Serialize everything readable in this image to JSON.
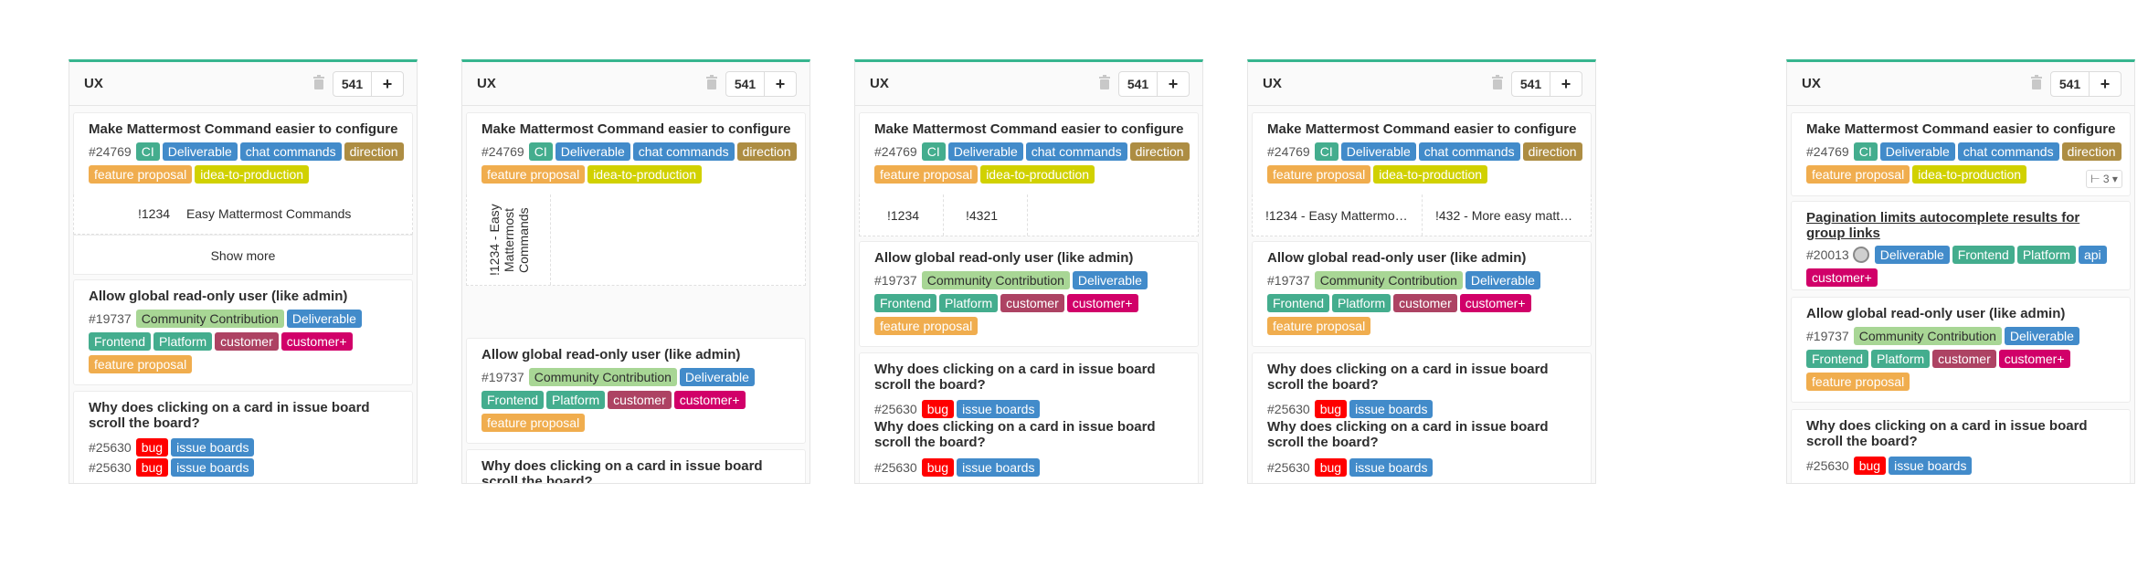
{
  "colors": {
    "accent": "#37b58f",
    "ci": "#44ad8e",
    "deliverable": "#428bca",
    "chat_commands": "#428bca",
    "direction": "#ad8d43",
    "feature_proposal": "#f0ad4e",
    "idea_to_production": "#d1d100",
    "community_contribution": "#a8d695",
    "frontend": "#44ad8e",
    "platform": "#44ad8e",
    "customer": "#ad4363",
    "customer_plus": "#d10069",
    "bug": "#ff0000",
    "issue_boards": "#428bca",
    "api": "#428bca"
  },
  "board": {
    "title": "UX",
    "count": "541",
    "add_label": "+"
  },
  "issues": {
    "configure": {
      "title": "Make Mattermost Command easier to configure",
      "iid": "#24769",
      "labels": [
        "CI",
        "Deliverable",
        "chat commands",
        "direction",
        "feature proposal",
        "idea-to-production"
      ]
    },
    "readonly": {
      "title": "Allow global read-only user (like admin)",
      "iid": "#19737",
      "labels": [
        "Community Contribution",
        "Deliverable",
        "Frontend",
        "Platform",
        "customer",
        "customer+",
        "feature proposal"
      ]
    },
    "scroll": {
      "title": "Why does clicking on a card in issue board scroll the board?",
      "iid": "#25630",
      "labels": [
        "bug",
        "issue boards"
      ]
    },
    "pagination": {
      "title": "Pagination limits autocomplete results for group links",
      "iid": "#20013",
      "labels": [
        "Deliverable",
        "Frontend",
        "Platform",
        "api",
        "customer+"
      ]
    }
  },
  "merge_requests": {
    "board1": {
      "ref": "!1234",
      "title": "Easy Mattermost Commands",
      "show_more": "Show more"
    },
    "board2": {
      "text": "!1234 - Easy Mattermost Commands"
    },
    "board3": {
      "ref1": "!1234",
      "ref2": "!4321"
    },
    "board4": {
      "mr1": "!1234 - Easy Mattermo…",
      "mr2": "!432 - More easy matt…"
    }
  },
  "weight": "3"
}
